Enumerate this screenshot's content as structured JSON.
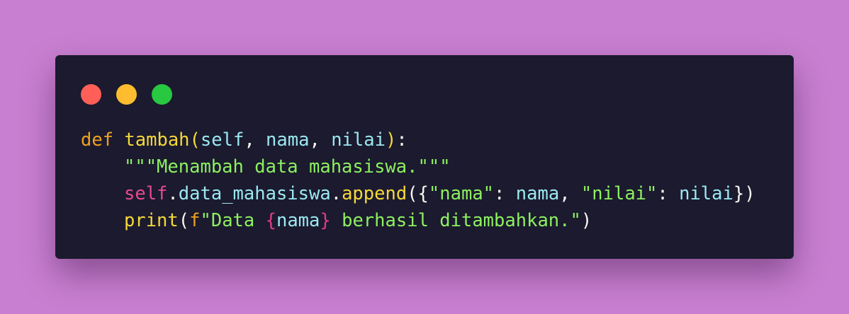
{
  "colors": {
    "background": "#c97fd1",
    "window": "#1b1a2e",
    "keyword": "#f0a020",
    "function": "#f5d83a",
    "param": "#9be8f2",
    "string": "#8df060",
    "punct": "#f8f8f2",
    "fstring_prefix": "#f5d83a",
    "interp_brace": "#e03b83",
    "paren_paren": "#f5d83a"
  },
  "window_controls": [
    {
      "name": "close-dot",
      "color": "#ff5f57"
    },
    {
      "name": "minimize-dot",
      "color": "#febc2e"
    },
    {
      "name": "maximize-dot",
      "color": "#28c840"
    }
  ],
  "code": {
    "line1": {
      "kw": "def",
      "sp": " ",
      "fn": "tambah",
      "open": "(",
      "p1": "self",
      "c1": ", ",
      "p2": "nama",
      "c2": ", ",
      "p3": "nilai",
      "close": ")",
      "colon": ":"
    },
    "line2": {
      "doc": "\"\"\"Menambah data mahasiswa.\"\"\""
    },
    "line3": {
      "obj": "self",
      "dot1": ".",
      "attr": "data_mahasiswa",
      "dot2": ".",
      "method": "append",
      "open": "({",
      "k1": "\"nama\"",
      "colon1": ": ",
      "v1": "nama",
      "comma": ", ",
      "k2": "\"nilai\"",
      "colon2": ": ",
      "v2": "nilai",
      "close": "})"
    },
    "line4": {
      "fn": "print",
      "open": "(",
      "prefix": "f",
      "s1": "\"Data ",
      "lbrace": "{",
      "var": "nama",
      "rbrace": "}",
      "s2": " berhasil ditambahkan.\"",
      "close": ")"
    }
  }
}
